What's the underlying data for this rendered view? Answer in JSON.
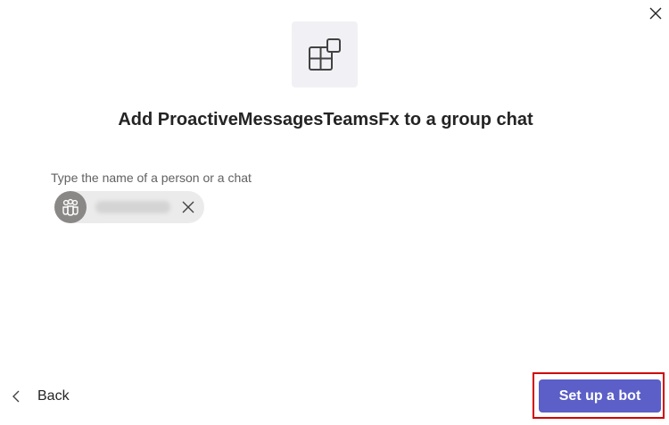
{
  "dialog": {
    "title": "Add ProactiveMessagesTeamsFx to a group chat",
    "close_icon": "close-icon",
    "app_icon": "apps-icon"
  },
  "picker": {
    "label": "Type the name of a person or a chat",
    "selected_chip": {
      "avatar_icon": "group-chat-icon",
      "remove_icon": "close-icon"
    }
  },
  "footer": {
    "back_label": "Back",
    "back_icon": "chevron-left-icon",
    "primary_label": "Set up a bot"
  },
  "colors": {
    "primary": "#5b5fc7",
    "highlight_outline": "#d00000",
    "icon_tile_bg": "#f1f1f5",
    "chip_bg": "#ebebeb"
  }
}
